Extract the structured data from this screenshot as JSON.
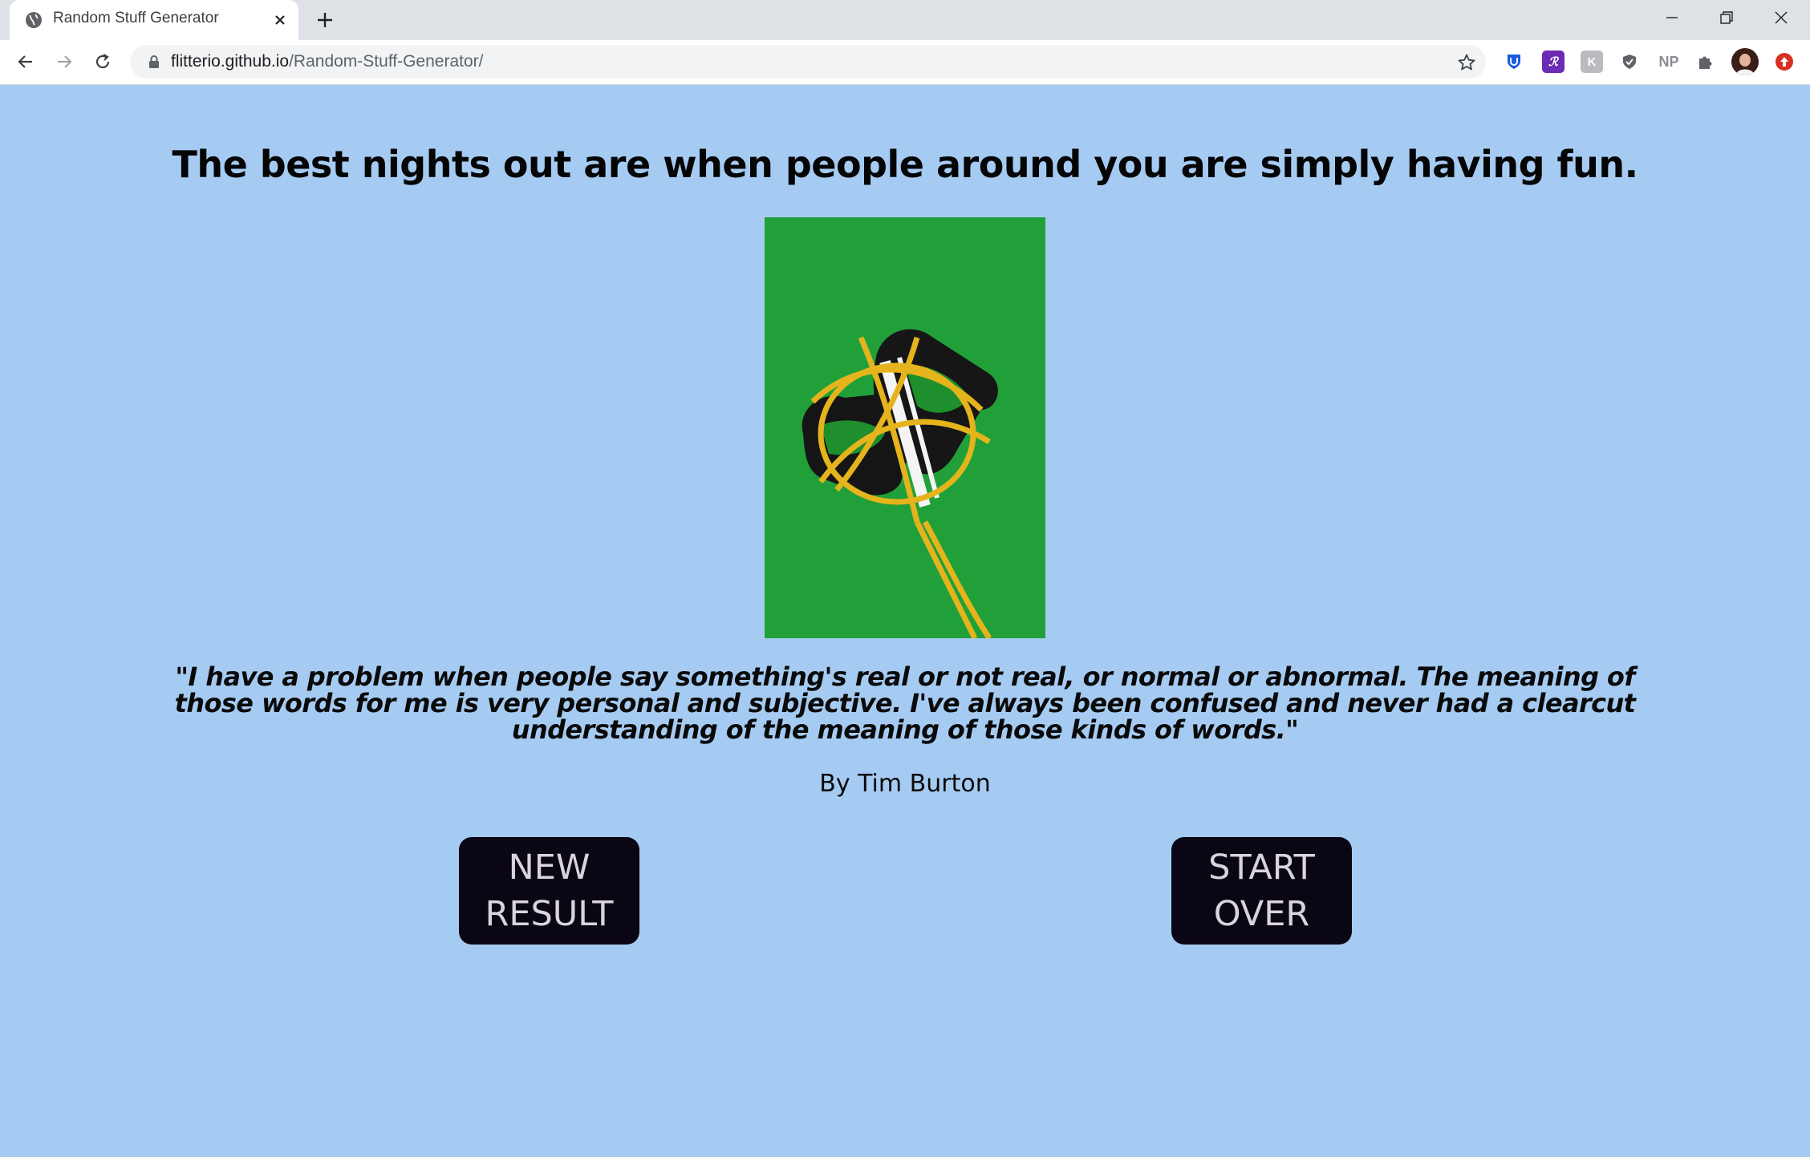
{
  "browser": {
    "tab_title": "Random Stuff Generator",
    "url_host": "flitterio.github.io",
    "url_path": "/Random-Stuff-Generator/",
    "extensions": [
      "bitwarden-icon",
      "regex-icon",
      "keep-icon",
      "shield-icon",
      "np-icon",
      "puzzle-icon",
      "avatar",
      "update-icon"
    ],
    "np_label": "NP"
  },
  "page": {
    "headline": "The best nights out are when people around you are simply having fun.",
    "image_subject": "sneakers wrapped in gold chains on green background",
    "quote": "\"I have a problem when people say something's real or not real, or normal or abnormal. The meaning of those words for me is very personal and subjective. I've always been confused and never had a clearcut understanding of the meaning of those kinds of words.\"",
    "author": "By Tim Burton",
    "buttons": {
      "new_result": "NEW RESULT",
      "start_over": "START OVER"
    }
  },
  "colors": {
    "background": "#a6cbf2",
    "button_bg": "#0b0613",
    "button_text": "#d8d4dc",
    "photo_bg": "#21a03a"
  }
}
